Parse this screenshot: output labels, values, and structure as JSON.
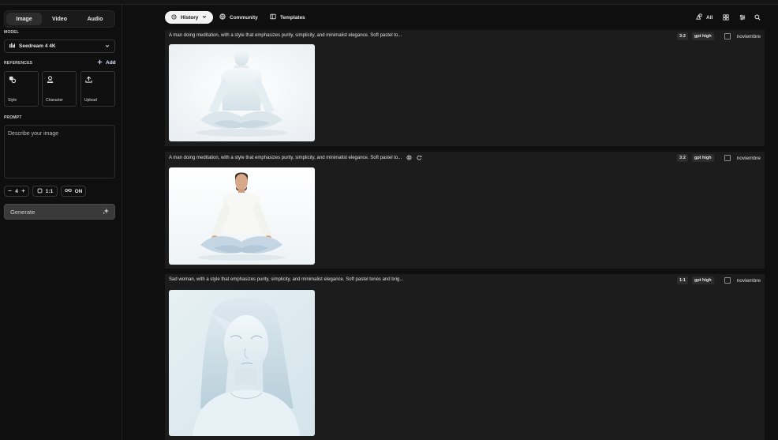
{
  "sidebar": {
    "tabs": [
      {
        "label": "Image"
      },
      {
        "label": "Video"
      },
      {
        "label": "Audio"
      }
    ],
    "model_label": "MODEL",
    "model_value": "Seedream 4 4K",
    "references_label": "REFERENCES",
    "add_label": "Add",
    "ref_cards": [
      {
        "label": "Style",
        "icon": "style-icon"
      },
      {
        "label": "Character",
        "icon": "person-icon"
      },
      {
        "label": "Upload",
        "icon": "upload-icon"
      }
    ],
    "prompt_label": "PROMPT",
    "prompt_placeholder": "Describe your image",
    "count_value": "4",
    "ratio_value": "1:1",
    "loop_value": "ON",
    "generate_label": "Generate"
  },
  "nav": {
    "history_label": "History",
    "community_label": "Community",
    "templates_label": "Templates",
    "all_label": "All"
  },
  "cards": [
    {
      "description": "A man doing meditation, with a style that emphasizes purity, simplicity, and minimalist elegance. Soft pastel to...",
      "ratio": "3:2",
      "quality": "gpt high",
      "date": "noviembre",
      "image": "white statue of a man meditating in lotus pose"
    },
    {
      "description": "A man doing meditation, with a style that emphasizes purity, simplicity, and minimalist elegance. Soft pastel to...",
      "ratio": "3:2",
      "quality": "gpt high",
      "date": "noviembre",
      "image": "man in white t-shirt meditating in lotus pose"
    },
    {
      "description": "Sad woman, with a style that emphasizes purity, simplicity, and minimalist elegance. Soft pastel tones and brig...",
      "ratio": "1:1",
      "quality": "gpt high",
      "date": "noviembre",
      "image": "pale blue statue of a sad woman looking down"
    }
  ]
}
